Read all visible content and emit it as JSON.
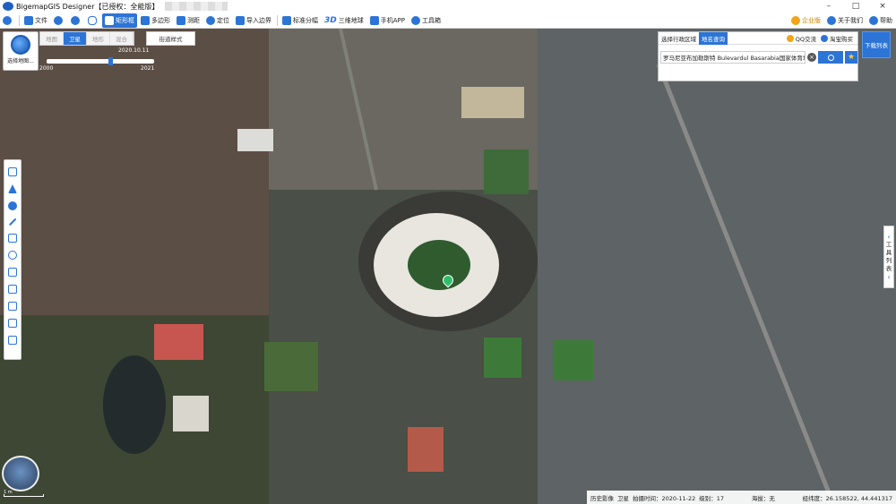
{
  "window": {
    "title": "BigemapGIS Designer【已授权：全能版】",
    "controls": [
      "–",
      "□",
      "×"
    ]
  },
  "toolbar": {
    "file": "文件",
    "zoom_in_icon": "zoom-in",
    "zoom_out_icon": "zoom-out",
    "pan_icon": "hand",
    "rect_select": "矩形框",
    "polygon": "多边形",
    "measure": "测距",
    "locate": "定位",
    "import_boundary": "导入边界",
    "standard_split": "标准分幅",
    "three_d_icon_text": "3D",
    "three_d_globe": "三维地球",
    "mobile_app": "手机APP",
    "toolbox": "工具箱",
    "enterprise": "企业版",
    "about_us": "关于我们",
    "help": "帮助"
  },
  "map_panel": {
    "select_region": "选择地图..."
  },
  "map_tabs": [
    {
      "label": "地图",
      "active": false
    },
    {
      "label": "卫星",
      "active": true
    },
    {
      "label": "地形",
      "active": false
    },
    {
      "label": "混合",
      "active": false
    }
  ],
  "street_style": "街道样式",
  "timeline": {
    "current": "2020.10.11",
    "start_year": "2000",
    "end_year": "2021",
    "position_fraction": 0.6
  },
  "search": {
    "tab_admin": "选择行政区域",
    "tab_place": "地名查询",
    "qq": "QQ交流",
    "taobao": "淘宝购买",
    "query": "罗马尼亚布加勒斯特 Bulevardul Basarabia国家体育场",
    "clear": "×",
    "star": "★"
  },
  "download_list": "下载列表",
  "right_dock": {
    "chars": [
      "工",
      "具",
      "列",
      "表"
    ],
    "arrow_top": "‹",
    "arrow_bottom": "‹"
  },
  "scale": "1 m",
  "status": {
    "history": "历史影像",
    "layer": "卫星",
    "shot_time": "拍摄时间：2020-11-22",
    "level": "级别：17",
    "altitude": "海拔：无",
    "coords": "经纬度：26.158522, 44.441317"
  },
  "colors": {
    "accent": "#2c74d6",
    "pin": "#2fbd6a",
    "gold": "#f0a51b"
  }
}
